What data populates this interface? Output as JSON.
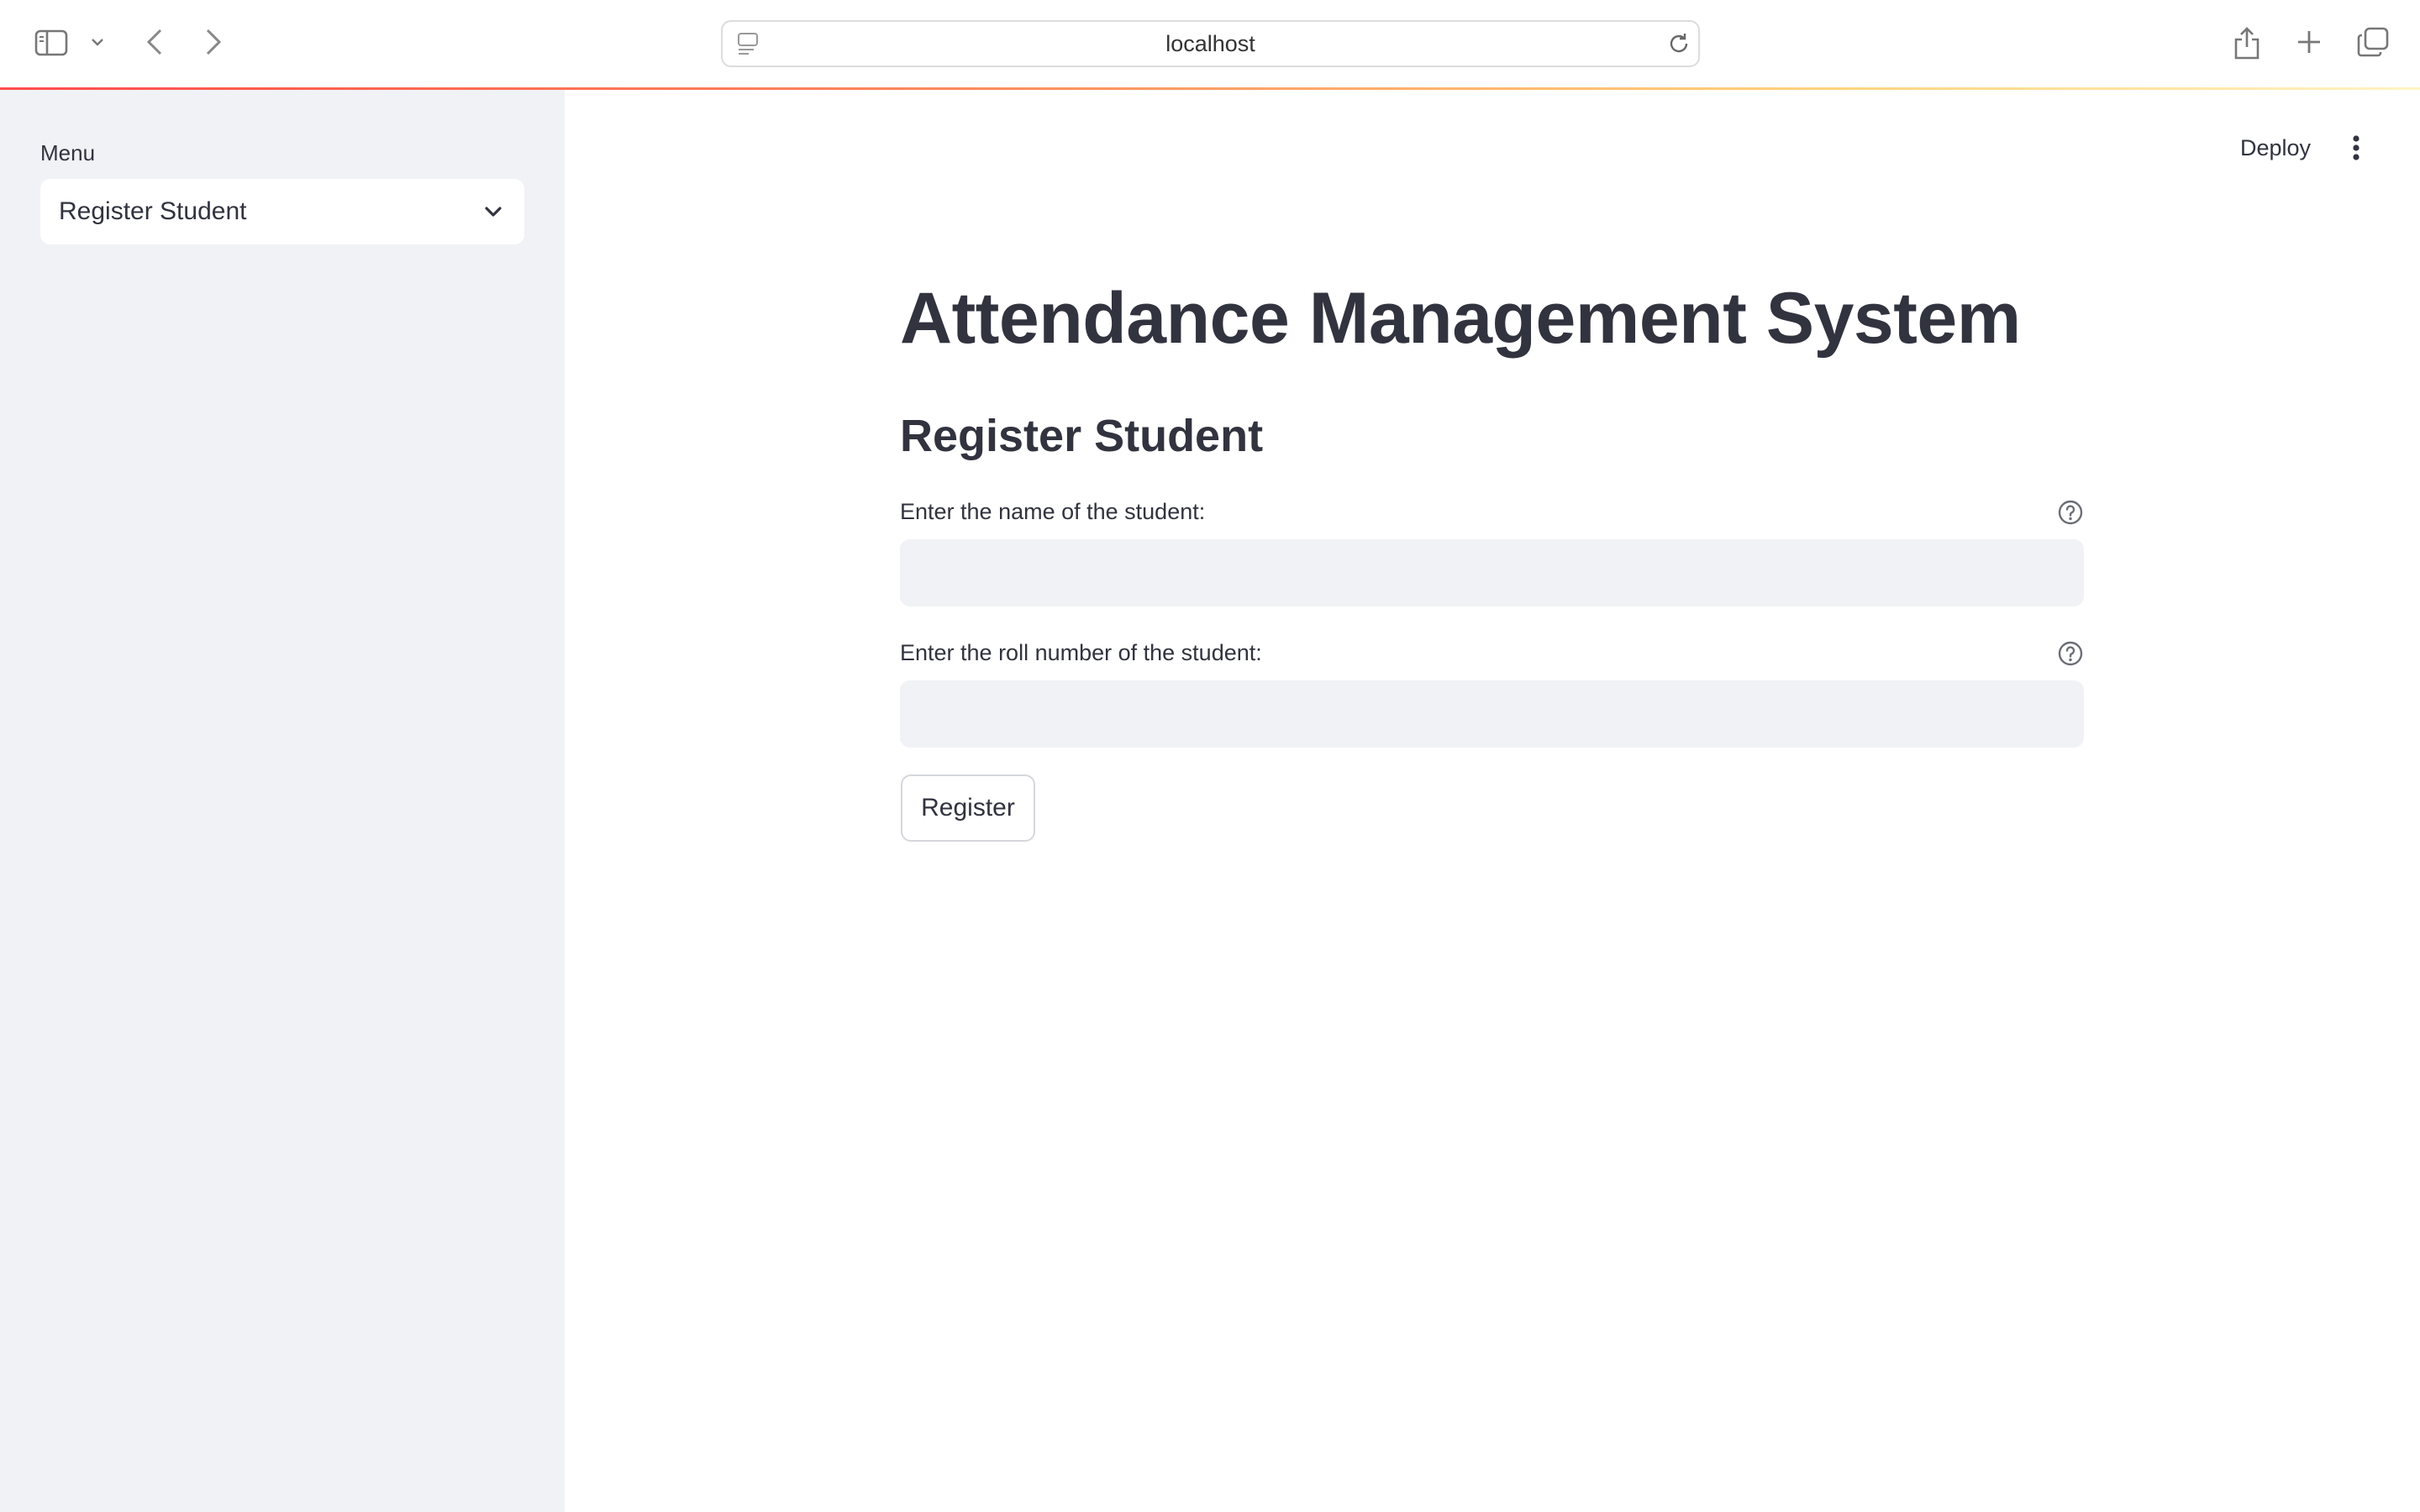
{
  "browser": {
    "address": "localhost",
    "icons": [
      "sidebar-toggle-icon",
      "chevron-down-icon",
      "back-arrow-icon",
      "forward-arrow-icon",
      "page-icon",
      "reload-icon",
      "share-icon",
      "plus-icon",
      "tabs-overview-icon"
    ]
  },
  "sidebar": {
    "menu_label": "Menu",
    "menu_selected": "Register Student"
  },
  "header": {
    "deploy_label": "Deploy"
  },
  "main": {
    "title": "Attendance Management System",
    "subtitle": "Register Student",
    "name_field": {
      "label": "Enter the name of the student:",
      "value": ""
    },
    "roll_field": {
      "label": "Enter the roll number of the student:",
      "value": ""
    },
    "register_button": "Register"
  },
  "colors": {
    "sidebar_bg": "#f0f2f6",
    "input_bg": "#f0f2f6",
    "text": "#31333f",
    "accent": "#ff4b4b"
  }
}
